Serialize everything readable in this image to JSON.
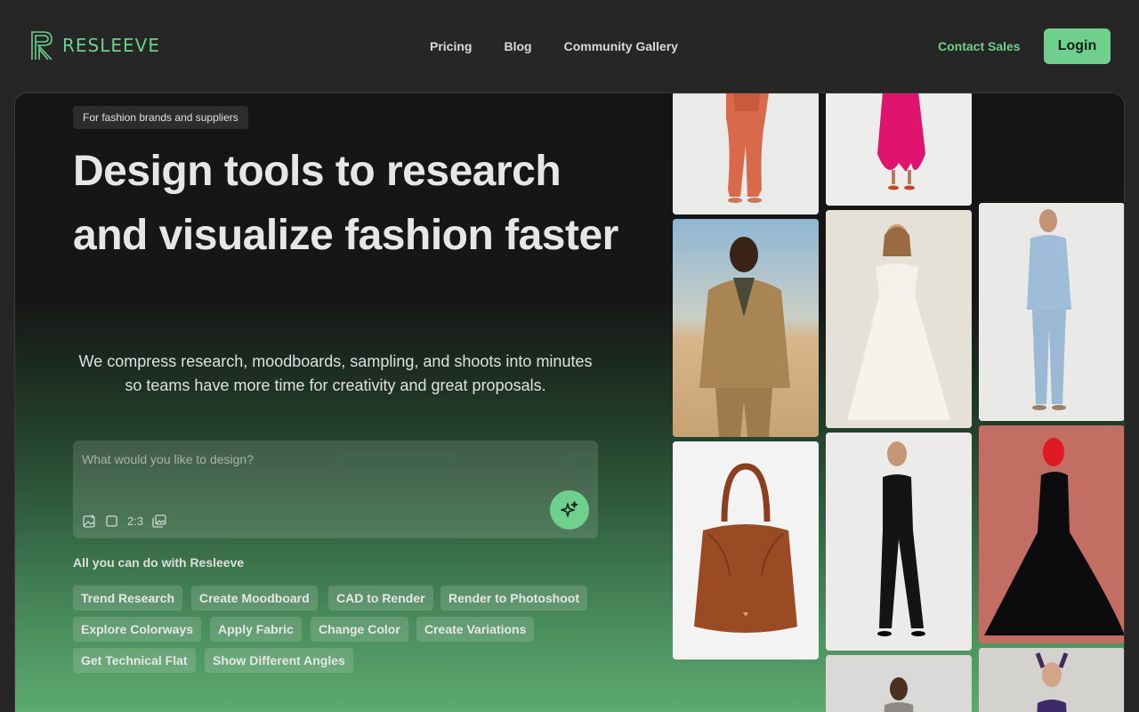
{
  "header": {
    "logo_text": "RESLEEVE",
    "nav": [
      "Pricing",
      "Blog",
      "Community Gallery"
    ],
    "contact_label": "Contact Sales",
    "login_label": "Login"
  },
  "hero": {
    "badge": "For fashion brands and suppliers",
    "headline": "Design tools to research and visualize fashion faster",
    "subtext": "We compress research, moodboards, sampling, and shoots into minutes so teams have more time for creativity and great proposals.",
    "prompt": {
      "placeholder": "What would you like to design?",
      "aspect_ratio": "2:3"
    },
    "capabilities_title": "All you can do with Resleeve",
    "capabilities": [
      "Trend Research",
      "Create Moodboard",
      "CAD to Render",
      "Render to Photoshoot",
      "Explore Colorways",
      "Apply Fabric",
      "Change Color",
      "Create Variations",
      "Get Technical Flat",
      "Show Different Angles"
    ]
  },
  "gallery": [
    {
      "name": "orange-pantsuit-photo"
    },
    {
      "name": "magenta-dress-photo"
    },
    {
      "name": "tan-suit-desert-photo"
    },
    {
      "name": "white-gown-photo"
    },
    {
      "name": "light-blue-suit-photo"
    },
    {
      "name": "brown-leather-tote-photo"
    },
    {
      "name": "black-jumpsuit-photo"
    },
    {
      "name": "black-gown-red-backdrop-photo"
    },
    {
      "name": "silver-outfit-photo"
    },
    {
      "name": "purple-corset-photo"
    }
  ],
  "colors": {
    "accent": "#6fcf8c",
    "background": "#262626"
  }
}
